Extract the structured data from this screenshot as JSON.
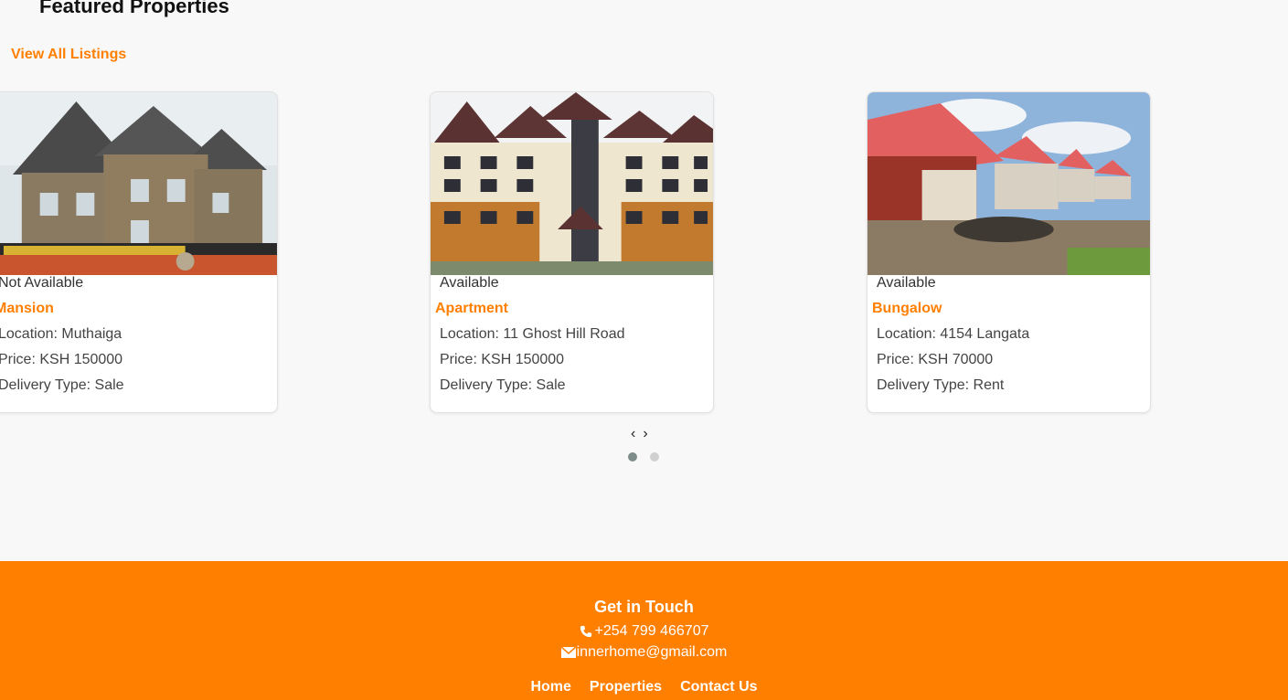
{
  "section": {
    "title": "Featured Properties",
    "view_all_label": "View All Listings"
  },
  "properties": [
    {
      "status": "Not Available",
      "type": "Mansion",
      "location": "Location: Muthaiga",
      "price": "Price: KSH 150000",
      "delivery": "Delivery Type: Sale"
    },
    {
      "status": "Available",
      "type": "Apartment",
      "location": "Location: 11 Ghost Hill Road",
      "price": "Price: KSH 150000",
      "delivery": "Delivery Type: Sale"
    },
    {
      "status": "Available",
      "type": "Bungalow",
      "location": "Location: 4154 Langata",
      "price": "Price: KSH 70000",
      "delivery": "Delivery Type: Rent"
    }
  ],
  "carousel": {
    "prev_glyph": "‹",
    "next_glyph": "›",
    "active_dot": 1,
    "dot_count": 2
  },
  "footer": {
    "title": "Get in Touch",
    "phone": "+254 799 466707",
    "email": "innerhome@gmail.com",
    "phone_icon": "phone-icon",
    "email_icon": "envelope-icon",
    "nav": [
      "Home",
      "Properties",
      "Contact Us"
    ]
  },
  "colors": {
    "accent": "#ff7f00",
    "background": "#f8f8f8"
  }
}
